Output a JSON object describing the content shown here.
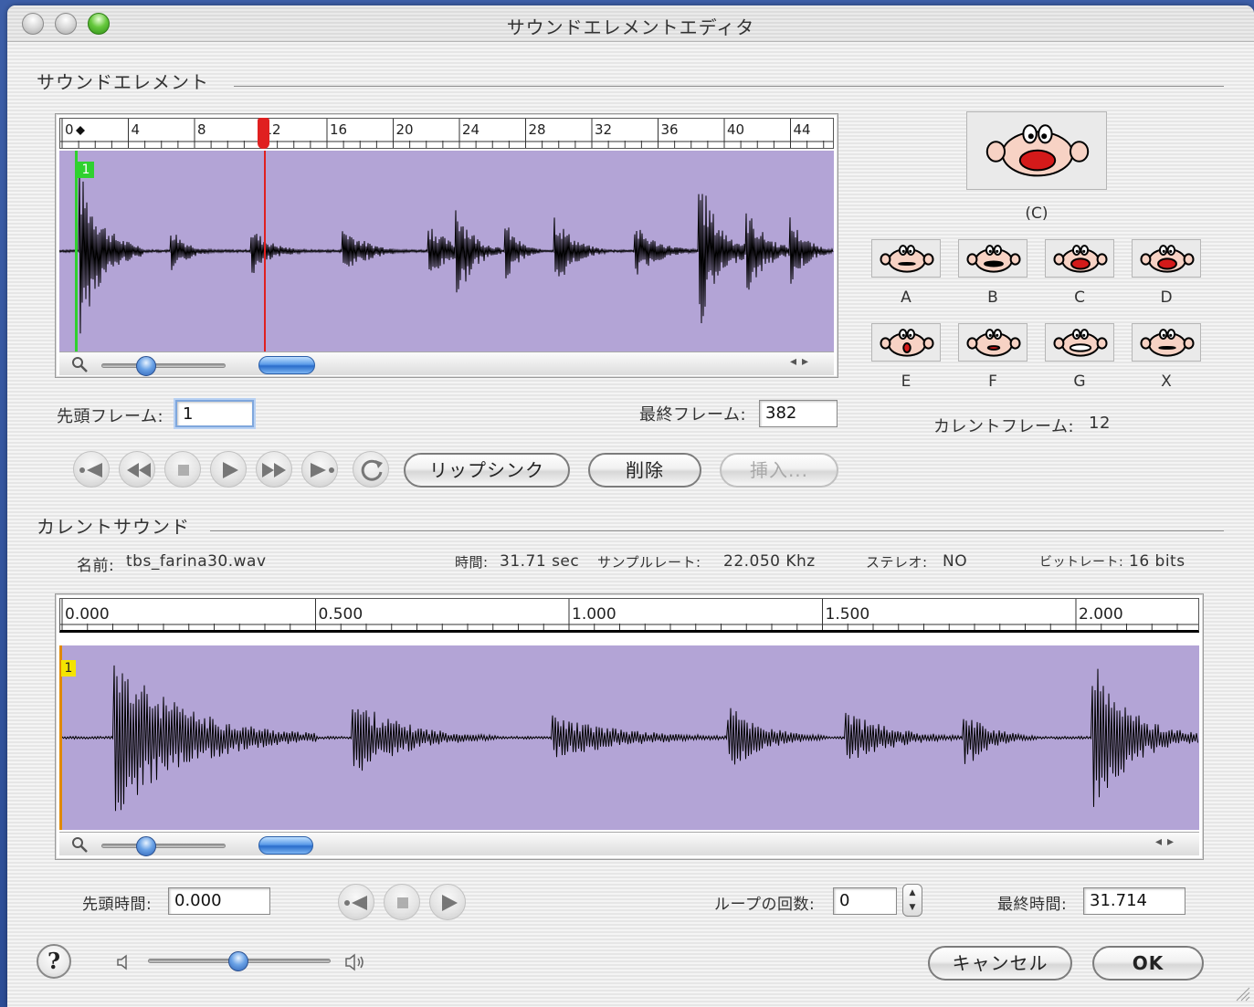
{
  "window": {
    "title": "サウンドエレメントエディタ"
  },
  "sound_element": {
    "section_title": "サウンドエレメント",
    "ruler_labels": [
      "0",
      "4",
      "8",
      "12",
      "16",
      "20",
      "24",
      "28",
      "32",
      "36",
      "40",
      "44"
    ],
    "marker": "1",
    "playhead_frame": 12,
    "start_frame_label": "先頭フレーム:",
    "start_frame_value": "1",
    "end_frame_label": "最終フレーム:",
    "end_frame_value": "382",
    "buttons": {
      "lipsync": "リップシンク",
      "delete": "削除",
      "insert": "挿入..."
    },
    "zoom_level": 0.4,
    "scroll_position": 0.0
  },
  "mouth_shapes": {
    "current_label": "(C)",
    "shapes": [
      "A",
      "B",
      "C",
      "D",
      "E",
      "F",
      "G",
      "X"
    ],
    "current_frame_label": "カレントフレーム:",
    "current_frame_value": "12"
  },
  "current_sound": {
    "section_title": "カレントサウンド",
    "name_label": "名前:",
    "name_value": "tbs_farina30.wav",
    "duration_label": "時間:",
    "duration_value": "31.71 sec",
    "sample_rate_label": "サンプルレート:",
    "sample_rate_value": "22.050 Khz",
    "stereo_label": "ステレオ:",
    "stereo_value": "NO",
    "bitrate_label": "ビットレート:",
    "bitrate_value": "16 bits",
    "ruler_labels": [
      "0.000",
      "0.500",
      "1.000",
      "1.500",
      "2.000"
    ],
    "marker": "1",
    "start_time_label": "先頭時間:",
    "start_time_value": "0.000",
    "loop_label": "ループの回数:",
    "loop_value": "0",
    "end_time_label": "最終時間:",
    "end_time_value": "31.714",
    "zoom_level": 0.4
  },
  "footer": {
    "help": "?",
    "volume": 0.5,
    "cancel": "キャンセル",
    "ok": "OK"
  },
  "colors": {
    "waveform_bg": "#b3a4d6",
    "playhead": "#e02020",
    "marker_green": "#2fd12f",
    "marker_yellow": "#f4e400",
    "accent_blue": "#3a78d4"
  }
}
